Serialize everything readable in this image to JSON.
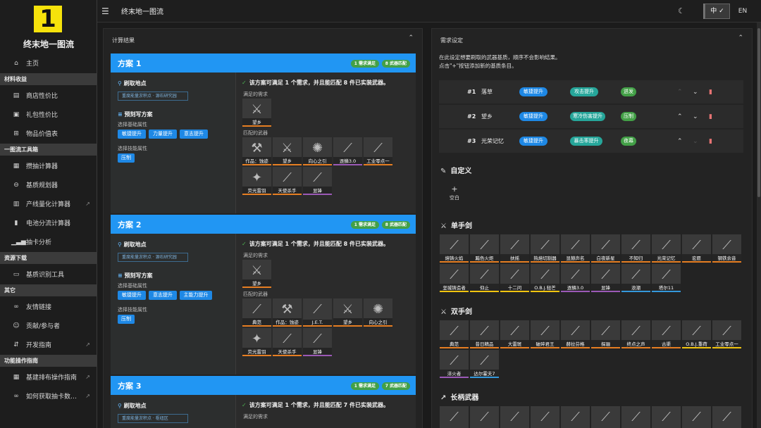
{
  "app": {
    "logo": "1",
    "title": "终末地一图流"
  },
  "header": {
    "title": "终末地一图流",
    "lang_zh": "中 ✓",
    "lang_en": "EN"
  },
  "sidebar": {
    "home": "主页",
    "groups": [
      {
        "title": "材料收益",
        "items": [
          "商店性价比",
          "礼包性价比",
          "物品价值表"
        ]
      },
      {
        "title": "一图流工具箱",
        "items": [
          "攒抽计算器",
          "基质规划器",
          "产线量化计算器",
          "电池分流计算器",
          "抽卡分析"
        ]
      },
      {
        "title": "资源下载",
        "items": [
          "基质识别工具"
        ]
      },
      {
        "title": "其它",
        "items": [
          "友情链接",
          "贡献/参与者",
          "开发指南"
        ]
      },
      {
        "title": "功能操作指南",
        "items": [
          "基建排布操作指南",
          "如何获取抽卡数…"
        ]
      }
    ]
  },
  "results": {
    "title": "计算结果",
    "plans": [
      {
        "name": "方案 1",
        "tag1": "1 需求满足",
        "tag2": "8 武器匹配",
        "farm_label": "刷取地点",
        "location": "重度能量淤积点 · 源石研究园",
        "preset_label": "预刻写方案",
        "base_label": "选择基础属性",
        "base": [
          "敏捷提升",
          "力量提升",
          "意志提升"
        ],
        "skill_label": "选择技能属性",
        "skill": [
          "压制"
        ],
        "ok": "该方案可满足 1 个需求，并且能匹配 8 件已实装武器。",
        "met_label": "满足的需求",
        "met": [
          "望乡"
        ],
        "match_label": "匹配的武器",
        "matched": [
          "作品：蚀迹",
          "望乡",
          "向心之引",
          "逐鳞3.0",
          "工业零点一",
          "荧光雷羽",
          "天使杀手",
          "显锋"
        ]
      },
      {
        "name": "方案 2",
        "tag1": "1 需求满足",
        "tag2": "8 武器匹配",
        "farm_label": "刷取地点",
        "location": "重度能量淤积点 · 源石研究园",
        "preset_label": "预刻写方案",
        "base_label": "选择基础属性",
        "base": [
          "敏捷提升",
          "意志提升",
          "主能力提升"
        ],
        "skill_label": "选择技能属性",
        "skill": [
          "压制"
        ],
        "ok": "该方案可满足 1 个需求，并且能匹配 8 件已实装武器。",
        "met_label": "满足的需求",
        "met": [
          "望乡"
        ],
        "match_label": "匹配的武器",
        "matched": [
          "典范",
          "作品：蚀迹",
          "J.E.T.",
          "望乡",
          "向心之引",
          "荧光雷羽",
          "天使杀手",
          "显锋"
        ]
      },
      {
        "name": "方案 3",
        "tag1": "1 需求满足",
        "tag2": "7 武器匹配",
        "farm_label": "刷取地点",
        "location": "重度能量淤积点 · 枢纽区",
        "ok": "该方案可满足 1 个需求，并且能匹配 7 件已实装武器。",
        "met_label": "满足的需求"
      }
    ]
  },
  "requirements": {
    "title": "需求设定",
    "desc1": "在此设定想要刷取的武器基质，顺序不会影响结果。",
    "desc2": "点击\"+\"按钮添加新的基质条目。",
    "rows": [
      {
        "no": "#1",
        "weapon": "落草",
        "a": "敏捷提升",
        "b": "攻击提升",
        "c": "迸发"
      },
      {
        "no": "#2",
        "weapon": "望乡",
        "a": "敏捷提升",
        "b": "寒冷伤害提升",
        "c": "压制"
      },
      {
        "no": "#3",
        "weapon": "光荣记忆",
        "a": "敏捷提升",
        "b": "暴击率提升",
        "c": "夜幕"
      }
    ],
    "custom_title": "自定义",
    "custom_plus": "+",
    "custom_empty": "空白",
    "sword_title": "单手剑",
    "swords": [
      "熔铸火焰",
      "黯色火炬",
      "扶摇",
      "热熔切割器",
      "显赫声名",
      "白夜新星",
      "不知归",
      "光荣记忆",
      "宏愿",
      "钢铁余音",
      "坚城铸造者",
      "仰止",
      "十二问",
      "O.B.J.轻芒",
      "逐鳞3.0",
      "显锋",
      "浪潮",
      "塔尔11"
    ],
    "gs_title": "双手剑",
    "greatswords": [
      "典范",
      "昔日精品",
      "大雷斑",
      "破碎君王",
      "赫拉芬格",
      "探骊",
      "终点之声",
      "古渠",
      "O.B.J.重荷",
      "工业零点一",
      "淬火者",
      "达尔霍夫7"
    ],
    "pole_title": "长柄武器"
  }
}
